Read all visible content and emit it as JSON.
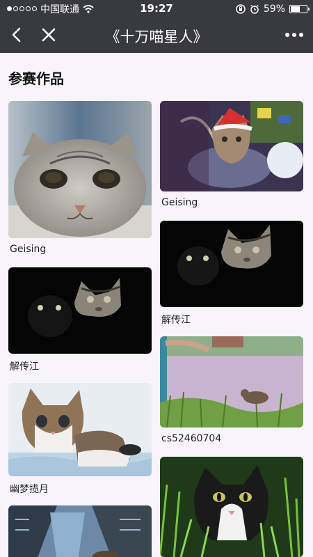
{
  "status_bar": {
    "carrier": "中国联通",
    "time": "19:27",
    "battery_percent": "59%",
    "battery_level": 0.59,
    "signal_bars_filled": 1,
    "signal_bars_total": 5
  },
  "nav": {
    "title": "《十万喵星人》",
    "back_icon": "chevron-left-icon",
    "close_icon": "close-icon",
    "more_icon": "more-dots-icon"
  },
  "section": {
    "title": "参赛作品"
  },
  "entries": [
    {
      "name": "Geising",
      "image": "cat-face-closeup"
    },
    {
      "name": "Geising",
      "image": "kitten-in-christmas-hat"
    },
    {
      "name": "解传江",
      "image": "two-cats-dark-1"
    },
    {
      "name": "解传江",
      "image": "two-cats-dark-2"
    },
    {
      "name": "幽梦揽月",
      "image": "tabby-kitten-on-blanket"
    },
    {
      "name": "cs52460704",
      "image": "cat-in-flowery-grass"
    },
    {
      "name": "",
      "image": "cat-cityscape"
    },
    {
      "name": "",
      "image": "black-white-cat-in-grass"
    }
  ]
}
